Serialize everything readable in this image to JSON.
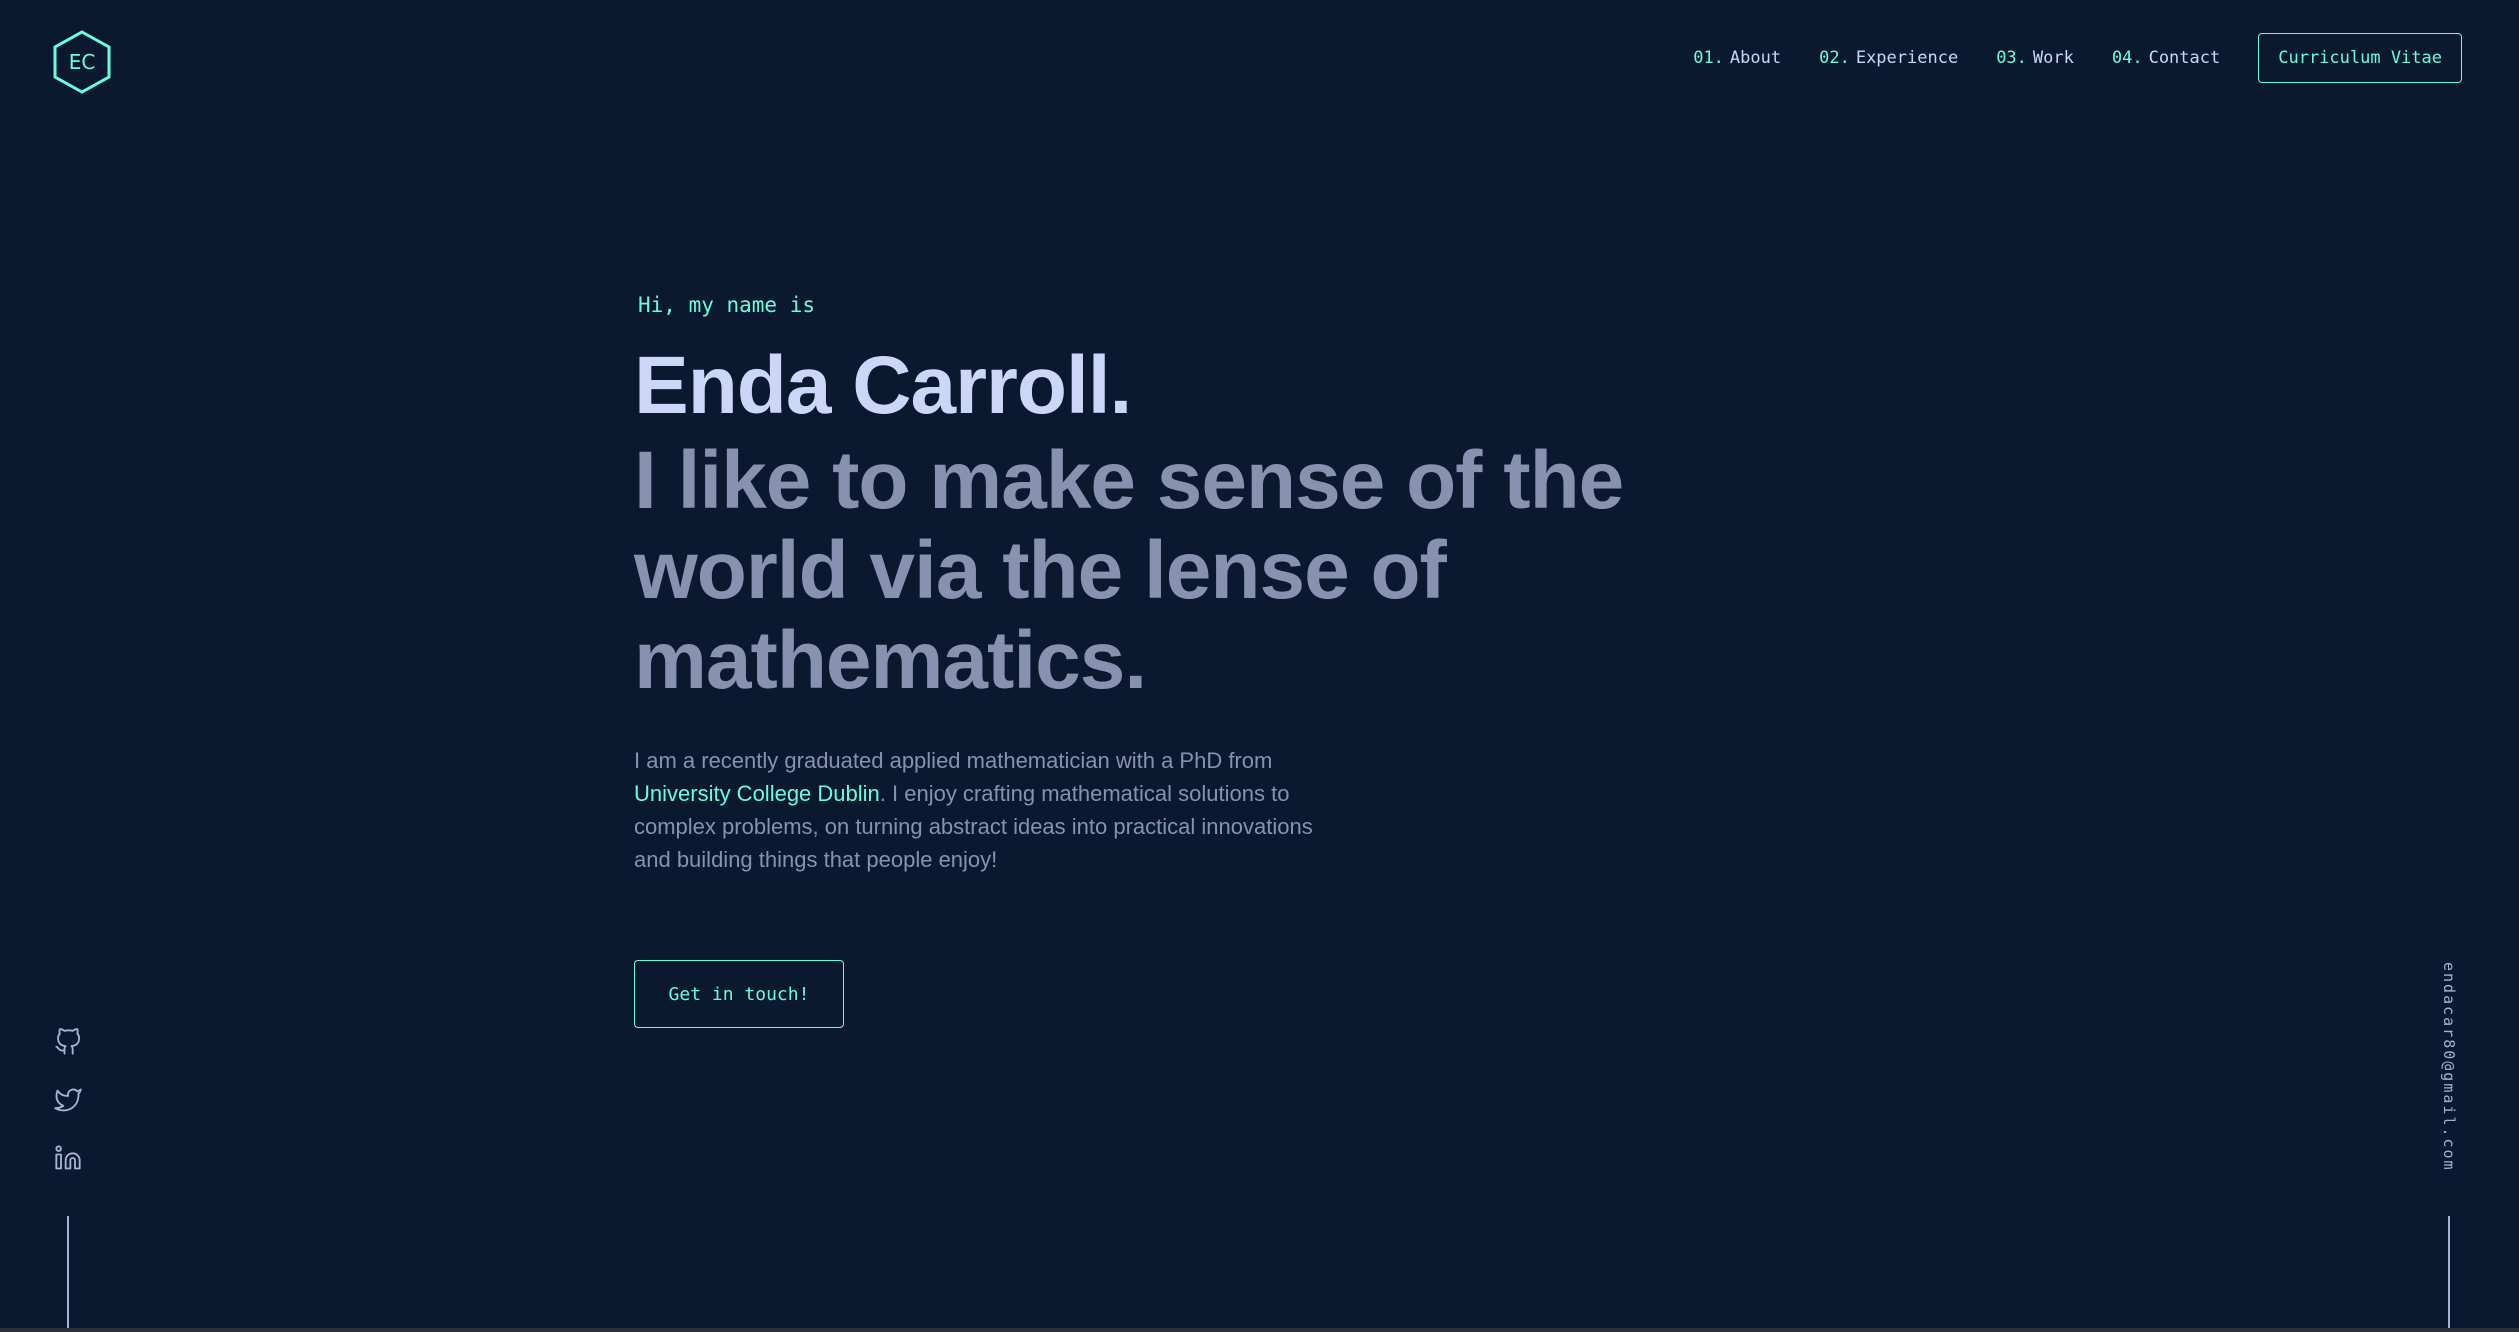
{
  "header": {
    "logo_text": "EC",
    "nav": [
      {
        "num": "01.",
        "label": "About"
      },
      {
        "num": "02.",
        "label": "Experience"
      },
      {
        "num": "03.",
        "label": "Work"
      },
      {
        "num": "04.",
        "label": "Contact"
      }
    ],
    "cv_label": "Curriculum Vitae"
  },
  "hero": {
    "intro": "Hi, my name is",
    "name": "Enda Carroll.",
    "tagline": "I like to make sense of the world via the lense of mathematics.",
    "bio_before": "I am a recently graduated applied mathematician with a PhD from ",
    "bio_link": "University College Dublin",
    "bio_after": ". I enjoy crafting mathematical solutions to complex problems, on turning abstract ideas into practical innovations and building things that people enjoy!",
    "cta_label": "Get in touch!"
  },
  "social": {
    "icons": [
      "github-icon",
      "twitter-icon",
      "linkedin-icon"
    ]
  },
  "email": "endacar80@gmail.com",
  "colors": {
    "background": "#0a192f",
    "accent": "#64ffda",
    "heading": "#ccd6f6",
    "text": "#8892b0"
  }
}
